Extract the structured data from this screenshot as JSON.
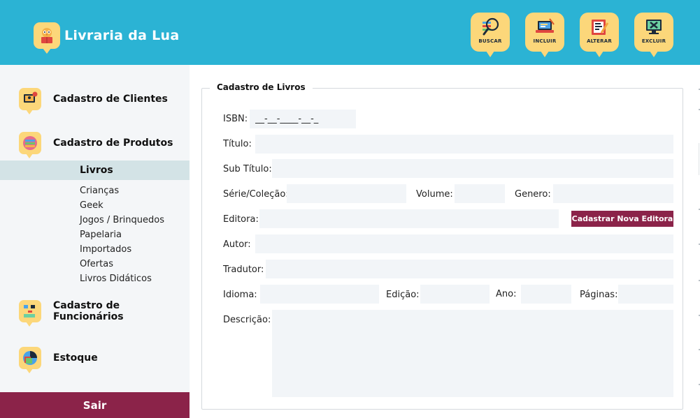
{
  "app": {
    "title": "Livraria da Lua"
  },
  "toolbar": {
    "search": "BUSCAR",
    "add": "INCLUIR",
    "edit": "ALTERAR",
    "delete": "EXCLUIR"
  },
  "sidebar": {
    "clients": "Cadastro de Clientes",
    "products": "Cadastro de Produtos",
    "active_sub": "Livros",
    "subs": [
      "Crianças",
      "Geek",
      "Jogos / Brinquedos",
      "Papelaria",
      "Importados",
      "Ofertas",
      "Livros Didáticos"
    ],
    "employees": "Cadastro de Funcionários",
    "stock": "Estoque",
    "logout": "Sair"
  },
  "form": {
    "legend": "Cadastro de Livros",
    "isbn_label": "ISBN:",
    "isbn_value": "__-__-____-__-_",
    "title_label": "Título:",
    "subtitle_label": "Sub Título:",
    "series_label": "Série/Coleção:",
    "volume_label": "Volume:",
    "genre_label": "Genero:",
    "publisher_label": "Editora:",
    "new_publisher_button": "Cadastrar Nova Editora",
    "author_label": "Autor:",
    "translator_label": "Tradutor:",
    "language_label": "Idioma:",
    "edition_label": "Edição:",
    "year_label": "Ano:",
    "pages_label": "Páginas:",
    "description_label": "Descrição:"
  },
  "colors": {
    "header": "#2bb3d4",
    "icon_badge": "#fcd77a",
    "accent": "#8b2349",
    "sidebar_bg": "#f4f6f8",
    "active_row": "#d3e3e6",
    "input_bg": "#f2f5f8"
  },
  "icons": {
    "brand": "owl-reading-icon",
    "search": "magnifier-list-icon",
    "add": "laptop-pen-icon",
    "edit": "document-pencil-icon",
    "delete": "screen-x-icon"
  }
}
